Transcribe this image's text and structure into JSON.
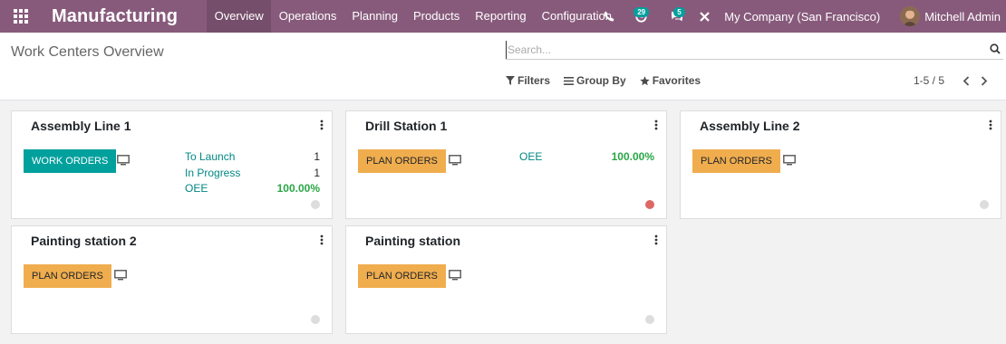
{
  "navbar": {
    "brand": "Manufacturing",
    "menu": [
      {
        "label": "Overview"
      },
      {
        "label": "Operations"
      },
      {
        "label": "Planning"
      },
      {
        "label": "Products"
      },
      {
        "label": "Reporting"
      },
      {
        "label": "Configuration"
      }
    ],
    "activities_count": "29",
    "messages_count": "5",
    "company": "My Company (San Francisco)",
    "user": "Mitchell Admin"
  },
  "control_panel": {
    "breadcrumb": "Work Centers Overview",
    "search_placeholder": "Search...",
    "filters_label": "Filters",
    "group_by_label": "Group By",
    "favorites_label": "Favorites",
    "pager": "1-5 / 5"
  },
  "workcenters": [
    {
      "name": "Assembly Line 1",
      "button": "WORK ORDERS",
      "stats": [
        {
          "label": "To Launch",
          "value": "1"
        },
        {
          "label": "In Progress",
          "value": "1"
        },
        {
          "label": "OEE",
          "value": "100.00%"
        }
      ]
    },
    {
      "name": "Drill Station 1",
      "button": "PLAN ORDERS",
      "stats": [
        {
          "label": "OEE",
          "value": "100.00%"
        }
      ]
    },
    {
      "name": "Assembly Line 2",
      "button": "PLAN ORDERS"
    },
    {
      "name": "Painting station 2",
      "button": "PLAN ORDERS"
    },
    {
      "name": "Painting station",
      "button": "PLAN ORDERS"
    }
  ],
  "colors": {
    "navbar": "#875a7b",
    "primary_button": "#00a09d",
    "plan_button": "#f0ad4e",
    "oee_value": "#28a745",
    "status_red": "#dc6965"
  }
}
